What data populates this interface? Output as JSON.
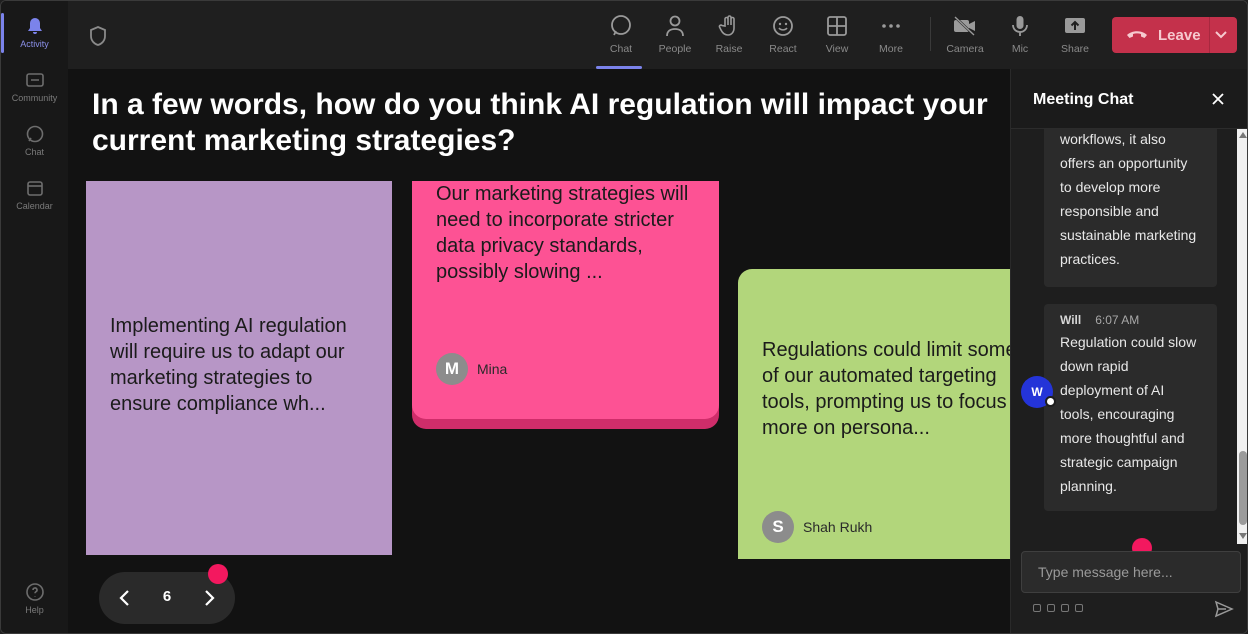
{
  "rail": {
    "items": [
      {
        "label": "Activity",
        "icon": "bell-icon"
      },
      {
        "label": "Community",
        "icon": "community-icon"
      },
      {
        "label": "Chat",
        "icon": "chat-icon"
      },
      {
        "label": "Calendar",
        "icon": "calendar-icon"
      }
    ],
    "help_label": "Help"
  },
  "toolbar": {
    "chat": "Chat",
    "people": "People",
    "raise": "Raise",
    "react": "React",
    "view": "View",
    "more": "More",
    "camera": "Camera",
    "mic": "Mic",
    "share": "Share",
    "leave": "Leave"
  },
  "stage": {
    "question": "In a few words, how do you think AI regulation will impact your current marketing strategies?",
    "cards": [
      {
        "text": "Implementing AI regulation will require us to adapt our marketing strategies to ensure compliance wh...",
        "color": "#b796c6"
      },
      {
        "text": "Our marketing strategies will need to incorporate stricter data privacy standards, possibly slowing ...",
        "author": "Mina",
        "initial": "M",
        "color": "#fd5294"
      },
      {
        "text": "Regulations could limit some of our automated targeting tools, prompting us to focus more on persona...",
        "author": "Shah Rukh",
        "initial": "S",
        "color": "#b2d67b"
      }
    ],
    "page_number": "6"
  },
  "chat": {
    "title": "Meeting Chat",
    "messages": [
      {
        "text": "workflows, it also offers an opportunity to develop more responsible and sustainable marketing practices."
      },
      {
        "sender": "Will",
        "initial": "W",
        "time": "6:07 AM",
        "text": "Regulation could slow down rapid deployment of AI tools, encouraging more thoughtful and strategic campaign planning."
      }
    ],
    "compose_placeholder": "Type message here..."
  },
  "colors": {
    "accent": "#7b83eb",
    "leave": "#c4314b",
    "marker": "#f3185f"
  }
}
